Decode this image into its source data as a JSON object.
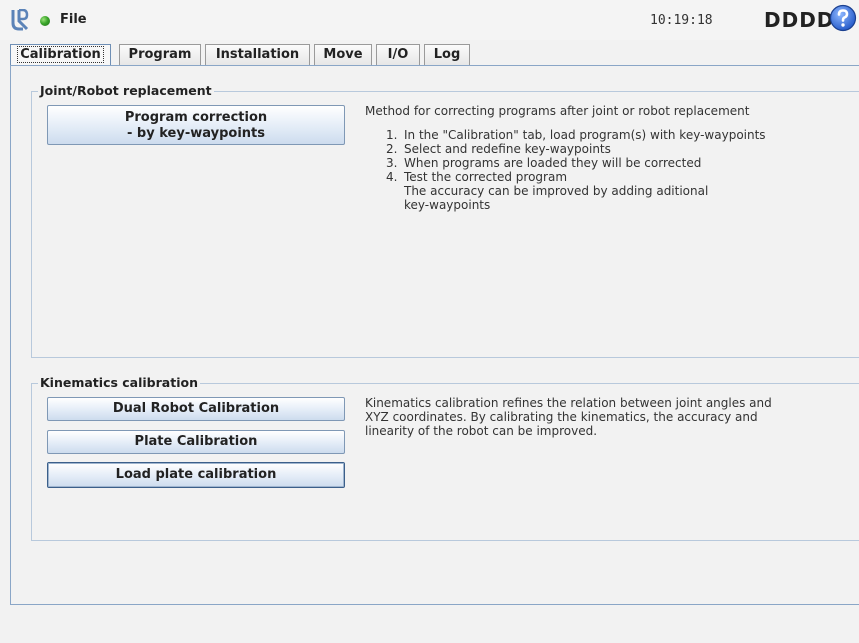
{
  "header": {
    "file_label": "File",
    "clock": "10:19:18",
    "robot_name": "DDDD",
    "status_color": "#3aa52a",
    "help_icon": "question-circle-icon",
    "logo_icon": "ur-logo-icon"
  },
  "tabs": [
    {
      "label": "Calibration",
      "active": true
    },
    {
      "label": "Program"
    },
    {
      "label": "Installation"
    },
    {
      "label": "Move"
    },
    {
      "label": "I/O"
    },
    {
      "label": "Log"
    }
  ],
  "joint_group": {
    "title": "Joint/Robot replacement",
    "button_line1": "Program correction",
    "button_line2": "- by key-waypoints",
    "description": "Method for correcting programs after joint or robot replacement",
    "steps": [
      {
        "num": "1.",
        "text": "In the \"Calibration\" tab, load program(s) with key-waypoints"
      },
      {
        "num": "2.",
        "text": "Select and redefine key-waypoints"
      },
      {
        "num": "3.",
        "text": "When programs are loaded they will be corrected"
      },
      {
        "num": "4.",
        "text": "Test the corrected program"
      }
    ],
    "note_line1": "The accuracy can be improved by adding aditional",
    "note_line2": "key-waypoints"
  },
  "kinematics_group": {
    "title": "Kinematics calibration",
    "dual_robot_button": "Dual Robot Calibration",
    "plate_button": "Plate Calibration",
    "load_plate_button": "Load plate calibration",
    "desc_line1": "Kinematics calibration refines the relation between joint angles and",
    "desc_line2": "XYZ coordinates. By calibrating the kinematics, the accuracy and",
    "desc_line3": "linearity of the robot can be improved."
  },
  "colors": {
    "accent_border": "#8aa6c7",
    "button_border": "#7f98b5"
  }
}
